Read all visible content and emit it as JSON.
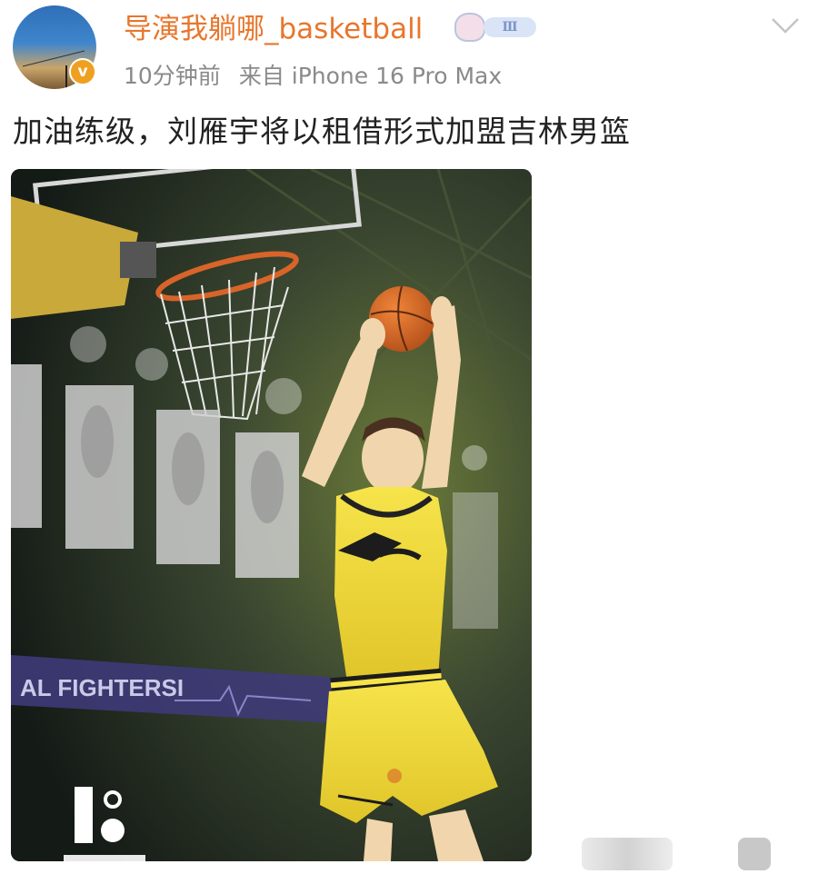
{
  "post": {
    "author": {
      "name": "导演我躺哪_basketball",
      "verified": true,
      "verified_color": "#f0a020",
      "level_badge": "Ⅲ",
      "avatar_icon": "sunset-sky-avatar"
    },
    "time": "10分钟前",
    "source": "来自 iPhone 16 Pro Max",
    "text": "加油练级，刘雁宇将以租借形式加盟吉林男篮",
    "menu_icon": "chevron-down-icon",
    "image": {
      "banner_text": "AL FIGHTERSI",
      "subject": "basketball-player-dunking-yellow-jersey"
    }
  },
  "colors": {
    "username": "#e8762c",
    "meta": "#8a8a8a",
    "text": "#222222",
    "jersey": "#f2dc3a"
  }
}
